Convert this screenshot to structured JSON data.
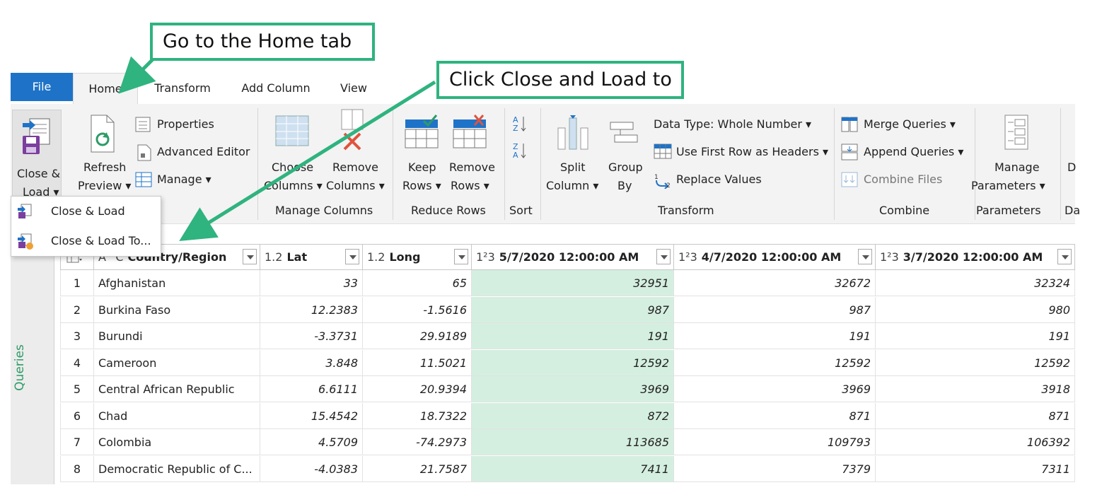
{
  "callouts": {
    "home": "Go to the Home tab",
    "close_load": "Click Close and Load to"
  },
  "tabs": [
    "File",
    "Home",
    "Transform",
    "Add Column",
    "View"
  ],
  "ribbon": {
    "close_load": "Close &",
    "close_load2": "Load",
    "refresh": "Refresh",
    "preview": "Preview",
    "properties": "Properties",
    "advanced_editor": "Advanced Editor",
    "manage": "Manage",
    "choose": "Choose",
    "choose2": "Columns",
    "remove": "Remove",
    "remove2": "Columns",
    "keep": "Keep",
    "keep2": "Rows",
    "remove_rows": "Remove",
    "remove_rows2": "Rows",
    "split": "Split",
    "split2": "Column",
    "group": "Group",
    "group2": "By",
    "data_type": "Data Type: Whole Number",
    "first_row": "Use First Row as Headers",
    "replace": "Replace Values",
    "merge": "Merge Queries",
    "append": "Append Queries",
    "combine_files": "Combine Files",
    "manage_params": "Manage",
    "manage_params2": "Parameters",
    "cut": "D",
    "groups": {
      "manage_columns": "Manage Columns",
      "reduce_rows": "Reduce Rows",
      "sort": "Sort",
      "transform": "Transform",
      "combine": "Combine",
      "parameters": "Parameters",
      "cut": "Da"
    }
  },
  "dropdown": [
    "Close & Load",
    "Close & Load To..."
  ],
  "sidebar_label": "Queries",
  "table": {
    "columns": [
      {
        "type": "A^C",
        "name": "Country/Region"
      },
      {
        "type": "1.2",
        "name": "Lat"
      },
      {
        "type": "1.2",
        "name": "Long"
      },
      {
        "type": "1²3",
        "name": "5/7/2020 12:00:00 AM"
      },
      {
        "type": "1²3",
        "name": "4/7/2020 12:00:00 AM"
      },
      {
        "type": "1²3",
        "name": "3/7/2020 12:00:00 AM"
      }
    ],
    "rows": [
      [
        "1",
        "Afghanistan",
        "33",
        "65",
        "32951",
        "32672",
        "32324"
      ],
      [
        "2",
        "Burkina Faso",
        "12.2383",
        "-1.5616",
        "987",
        "987",
        "980"
      ],
      [
        "3",
        "Burundi",
        "-3.3731",
        "29.9189",
        "191",
        "191",
        "191"
      ],
      [
        "4",
        "Cameroon",
        "3.848",
        "11.5021",
        "12592",
        "12592",
        "12592"
      ],
      [
        "5",
        "Central African Republic",
        "6.6111",
        "20.9394",
        "3969",
        "3969",
        "3918"
      ],
      [
        "6",
        "Chad",
        "15.4542",
        "18.7322",
        "872",
        "871",
        "871"
      ],
      [
        "7",
        "Colombia",
        "4.5709",
        "-74.2973",
        "113685",
        "109793",
        "106392"
      ],
      [
        "8",
        "Democratic Republic of C...",
        "-4.0383",
        "21.7587",
        "7411",
        "7379",
        "7311"
      ]
    ]
  },
  "colors": {
    "accent": "#2fb37f",
    "file_tab": "#1e73c8",
    "highlight": "#d4efe0"
  }
}
